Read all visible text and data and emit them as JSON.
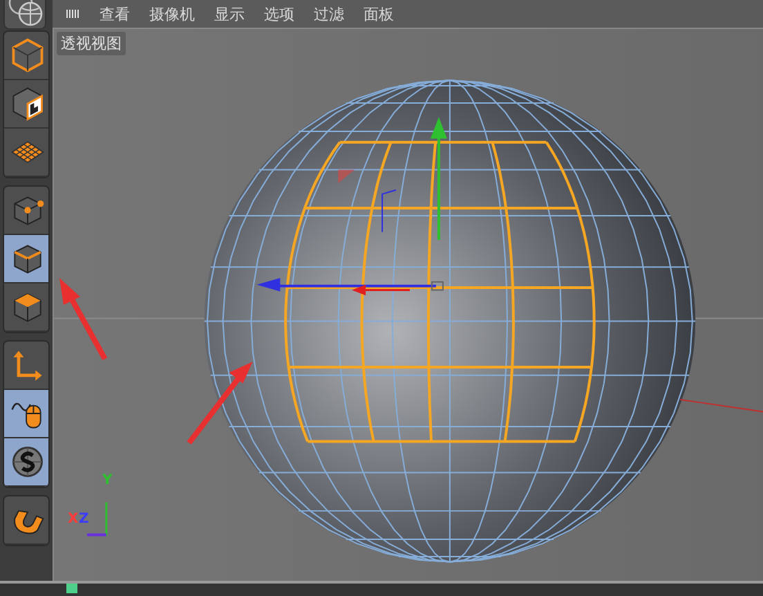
{
  "menu": [
    "查看",
    "摄像机",
    "显示",
    "选项",
    "过滤",
    "面板"
  ],
  "tool_groups": [
    [
      {
        "kind": "model",
        "selected": false
      },
      {
        "kind": "texture",
        "selected": false
      },
      {
        "kind": "workplane",
        "selected": false
      }
    ],
    [
      {
        "kind": "points",
        "selected": false
      },
      {
        "kind": "edges",
        "selected": true
      },
      {
        "kind": "polygons",
        "selected": false
      }
    ],
    [
      {
        "kind": "axis",
        "selected": false
      },
      {
        "kind": "tweak",
        "selected": true
      },
      {
        "kind": "snap",
        "selected": true
      }
    ],
    [
      {
        "kind": "magnet",
        "selected": false
      }
    ]
  ],
  "viewport": {
    "title": "透视视图",
    "axis_labels": [
      {
        "text": "Y",
        "color": "#2ec02e"
      },
      {
        "text": "X",
        "color": "#ff3c3c"
      },
      {
        "text": "Z",
        "color": "#3c3cff"
      }
    ]
  }
}
